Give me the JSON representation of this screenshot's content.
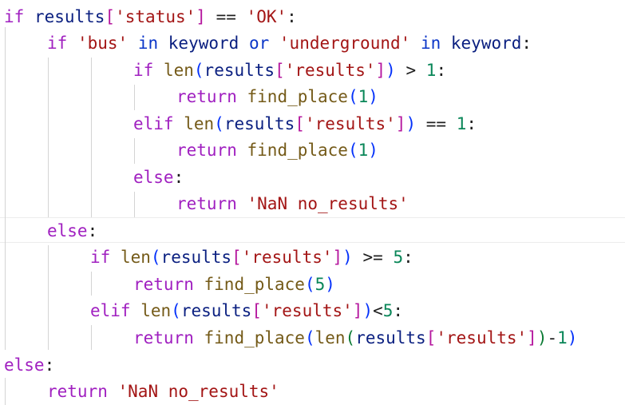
{
  "code": {
    "keywords": {
      "if": "if",
      "elif": "elif",
      "else": "else",
      "return": "return",
      "in": "in",
      "or": "or"
    },
    "functions": {
      "len": "len",
      "find_place": "find_place"
    },
    "identifiers": {
      "results": "results",
      "keyword": "keyword"
    },
    "strings": {
      "status": "'status'",
      "ok": "'OK'",
      "bus": "'bus'",
      "underground": "'underground'",
      "results_key": "'results'",
      "nan": "'NaN no_results'"
    },
    "numbers": {
      "one": "1",
      "five": "5"
    },
    "operators": {
      "eq": "==",
      "gt": ">",
      "ge": ">=",
      "lt": "<",
      "minus": "-",
      "colon": ":",
      "lparen": "(",
      "rparen": ")",
      "lbracket": "[",
      "rbracket": "]"
    }
  },
  "colors": {
    "keyword": "#a020c0",
    "builtin_keyword": "#0b36c8",
    "function": "#745a18",
    "identifier": "#0a1f80",
    "string": "#a31515",
    "number": "#098658",
    "bracket_level_1": "#0431fa",
    "bracket_level_2": "#b5179e",
    "bracket_level_3": "#0a7a33",
    "indent_guide": "#d4d4d4"
  }
}
